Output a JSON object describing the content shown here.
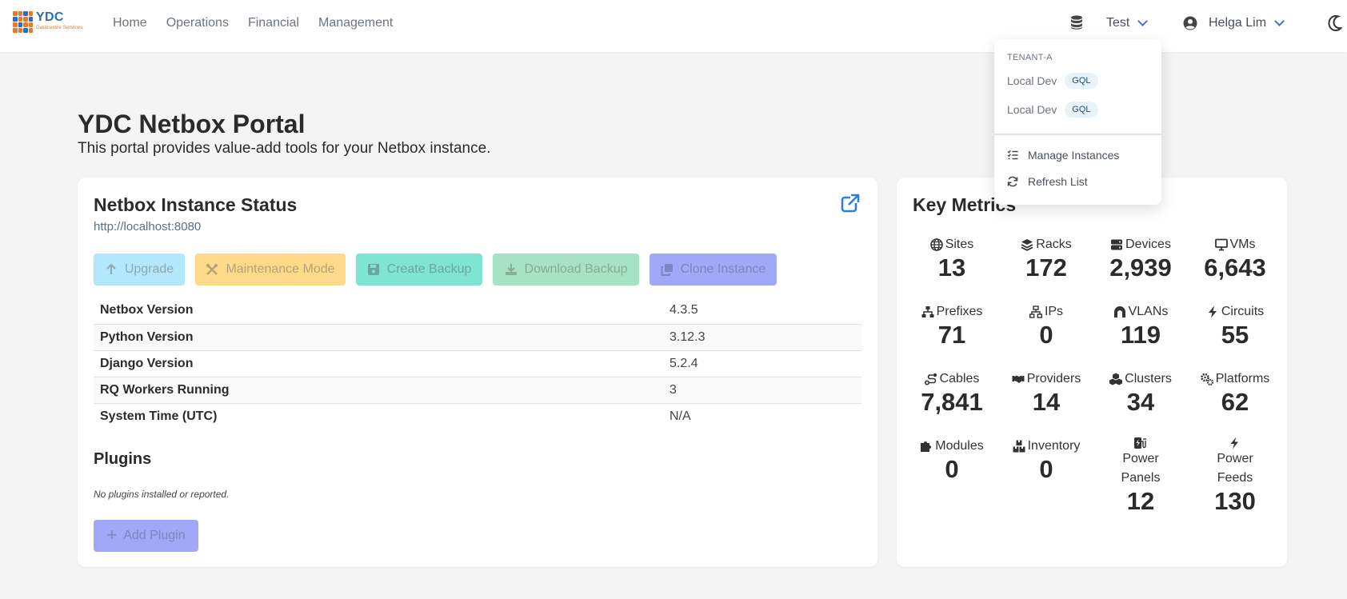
{
  "brand": {
    "name": "YDC",
    "tagline": "Datacentre Services"
  },
  "nav": {
    "links": [
      "Home",
      "Operations",
      "Financial",
      "Management"
    ]
  },
  "instance_selector": {
    "label": "Test"
  },
  "user": {
    "name": "Helga Lim"
  },
  "dropdown": {
    "group_header": "TENANT-A",
    "instances": [
      {
        "name": "Local Dev",
        "badge": "GQL"
      },
      {
        "name": "Local Dev",
        "badge": "GQL"
      }
    ],
    "actions": {
      "manage": "Manage Instances",
      "refresh": "Refresh List"
    }
  },
  "hero": {
    "title": "YDC Netbox Portal",
    "subtitle": "This portal provides value-add tools for your Netbox instance."
  },
  "status_card": {
    "title": "Netbox Instance Status",
    "url": "http://localhost:8080",
    "buttons": {
      "upgrade": "Upgrade",
      "maintenance": "Maintenance Mode",
      "create_backup": "Create Backup",
      "download_backup": "Download Backup",
      "clone": "Clone Instance"
    },
    "rows": [
      {
        "key": "Netbox Version",
        "value": "4.3.5"
      },
      {
        "key": "Python Version",
        "value": "3.12.3"
      },
      {
        "key": "Django Version",
        "value": "5.2.4"
      },
      {
        "key": "RQ Workers Running",
        "value": "3"
      },
      {
        "key": "System Time (UTC)",
        "value": "N/A"
      }
    ],
    "plugins": {
      "title": "Plugins",
      "empty_text": "No plugins installed or reported.",
      "add_button": "Add Plugin"
    }
  },
  "metrics_card": {
    "title": "Key Metrics",
    "items": [
      {
        "label": "Sites",
        "value": "13",
        "icon": "globe-icon"
      },
      {
        "label": "Racks",
        "value": "172",
        "icon": "layers-icon"
      },
      {
        "label": "Devices",
        "value": "2,939",
        "icon": "server-icon"
      },
      {
        "label": "VMs",
        "value": "6,643",
        "icon": "desktop-icon"
      },
      {
        "label": "Prefixes",
        "value": "71",
        "icon": "sitemap-icon"
      },
      {
        "label": "IPs",
        "value": "0",
        "icon": "network-wired-icon"
      },
      {
        "label": "VLANs",
        "value": "119",
        "icon": "tunnel-icon"
      },
      {
        "label": "Circuits",
        "value": "55",
        "icon": "bolt-icon"
      },
      {
        "label": "Cables",
        "value": "7,841",
        "icon": "route-icon"
      },
      {
        "label": "Providers",
        "value": "14",
        "icon": "handshake-icon"
      },
      {
        "label": "Clusters",
        "value": "34",
        "icon": "cubes-icon"
      },
      {
        "label": "Platforms",
        "value": "62",
        "icon": "gears-icon"
      },
      {
        "label": "Modules",
        "value": "0",
        "icon": "puzzle-icon"
      },
      {
        "label": "Inventory",
        "value": "0",
        "icon": "boxes-icon"
      },
      {
        "label": "Power Panels",
        "value": "12",
        "icon": "charging-station-icon"
      },
      {
        "label": "Power Feeds",
        "value": "130",
        "icon": "power-bolt-icon"
      }
    ]
  },
  "colors": {
    "accent": "#4d6bd6",
    "upgrade": "#b3e7fb",
    "maintenance": "#ffd98a",
    "backup": "#80e4d3",
    "download": "#a8e2c4",
    "clone": "#a0a8f7",
    "logo_blue": "#2d6db5",
    "logo_orange": "#e8792b"
  }
}
